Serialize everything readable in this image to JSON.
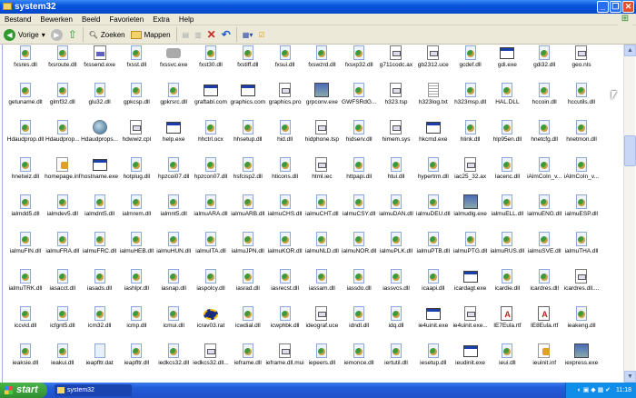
{
  "window": {
    "title": "system32"
  },
  "menu": [
    "Bestand",
    "Bewerken",
    "Beeld",
    "Favorieten",
    "Extra",
    "Help"
  ],
  "toolbar": {
    "back": "Vorige",
    "search": "Zoeken",
    "folders": "Mappen"
  },
  "rows": [
    [
      [
        "fxsres.dll",
        "d"
      ],
      [
        "fxsroute.dll",
        "d"
      ],
      [
        "fxssend.exe",
        "doc"
      ],
      [
        "fxsst.dll",
        "d"
      ],
      [
        "fxssvc.exe",
        "fax"
      ],
      [
        "fxst30.dll",
        "d"
      ],
      [
        "fxstiff.dll",
        "d"
      ],
      [
        "fxsui.dll",
        "d"
      ],
      [
        "fxswzrd.dll",
        "d"
      ],
      [
        "fxsxp32.dll",
        "d"
      ],
      [
        "g711codc.ax",
        "t"
      ],
      [
        "gb2312.uce",
        "t"
      ],
      [
        "gcdef.dll",
        "d"
      ],
      [
        "gdi.exe",
        "w"
      ],
      [
        "gdi32.dll",
        "d"
      ],
      [
        "geo.nls",
        "t"
      ]
    ],
    [
      [
        "getuname.dll",
        "d"
      ],
      [
        "glmf32.dll",
        "d"
      ],
      [
        "glu32.dll",
        "d"
      ],
      [
        "gpkcsp.dll",
        "d"
      ],
      [
        "gpkrsrc.dll",
        "d"
      ],
      [
        "graftabl.com",
        "w"
      ],
      [
        "graphics.com",
        "w"
      ],
      [
        "graphics.pro",
        "t"
      ],
      [
        "grpconv.exe",
        "app"
      ],
      [
        "GWFSRdG...",
        "d"
      ],
      [
        "h323.tsp",
        "t"
      ],
      [
        "h323log.txt",
        "txt"
      ],
      [
        "h323msp.dll",
        "d"
      ],
      [
        "HAL.DLL",
        "d"
      ],
      [
        "hccoin.dll",
        "d"
      ],
      [
        "hccutils.dll",
        "d"
      ]
    ],
    [
      [
        "Hdaudprop.dll",
        "d"
      ],
      [
        "Hdaudprop...",
        "d"
      ],
      [
        "Hdaudprops...",
        "globe"
      ],
      [
        "hdwwiz.cpl",
        "t"
      ],
      [
        "help.exe",
        "w"
      ],
      [
        "hhctrl.ocx",
        "d"
      ],
      [
        "hhsetup.dll",
        "d"
      ],
      [
        "hid.dll",
        "d"
      ],
      [
        "hidphone.tsp",
        "t"
      ],
      [
        "hidserv.dll",
        "d"
      ],
      [
        "himem.sys",
        "t"
      ],
      [
        "hkcmd.exe",
        "w"
      ],
      [
        "hlink.dll",
        "d"
      ],
      [
        "hlp95en.dll",
        "d"
      ],
      [
        "hnetcfg.dll",
        "d"
      ],
      [
        "hnetmon.dll",
        "d"
      ]
    ],
    [
      [
        "hnetwiz.dll",
        "d"
      ],
      [
        "homepage.inf",
        "inf"
      ],
      [
        "hostname.exe",
        "w"
      ],
      [
        "hotplug.dll",
        "d"
      ],
      [
        "hpzcoi07.dll",
        "d"
      ],
      [
        "hpzcon07.dll",
        "d"
      ],
      [
        "hsfcisp2.dll",
        "d"
      ],
      [
        "hticons.dll",
        "d"
      ],
      [
        "html.iec",
        "t"
      ],
      [
        "httpapi.dll",
        "d"
      ],
      [
        "htui.dll",
        "d"
      ],
      [
        "hypertrm.dll",
        "d"
      ],
      [
        "iac25_32.ax",
        "t"
      ],
      [
        "Iacenc.dll",
        "d"
      ],
      [
        "iAlmCoIn_v...",
        "d"
      ],
      [
        "iAlmCoIn_v...",
        "d"
      ]
    ],
    [
      [
        "ialmdd5.dll",
        "d"
      ],
      [
        "ialmdev5.dll",
        "d"
      ],
      [
        "ialmdnt5.dll",
        "d"
      ],
      [
        "ialmrem.dll",
        "d"
      ],
      [
        "ialmnt5.dll",
        "d"
      ],
      [
        "ialmuARA.dll",
        "d"
      ],
      [
        "ialmuARB.dll",
        "d"
      ],
      [
        "ialmuCHS.dll",
        "d"
      ],
      [
        "ialmuCHT.dll",
        "d"
      ],
      [
        "ialmuCSY.dll",
        "d"
      ],
      [
        "ialmuDAN.dll",
        "d"
      ],
      [
        "ialmuDEU.dll",
        "d"
      ],
      [
        "ialmudlg.exe",
        "app"
      ],
      [
        "ialmuELL.dll",
        "d"
      ],
      [
        "ialmuENG.dll",
        "d"
      ],
      [
        "ialmuESP.dll",
        "d"
      ]
    ],
    [
      [
        "ialmuFIN.dll",
        "d"
      ],
      [
        "ialmuFRA.dll",
        "d"
      ],
      [
        "ialmuFRC.dll",
        "d"
      ],
      [
        "ialmuHEB.dll",
        "d"
      ],
      [
        "ialmuHUN.dll",
        "d"
      ],
      [
        "ialmuITA.dll",
        "d"
      ],
      [
        "ialmuJPN.dll",
        "d"
      ],
      [
        "ialmuKOR.dll",
        "d"
      ],
      [
        "ialmuNLD.dll",
        "d"
      ],
      [
        "ialmuNOR.dll",
        "d"
      ],
      [
        "ialmuPLK.dll",
        "d"
      ],
      [
        "ialmuPTB.dll",
        "d"
      ],
      [
        "ialmuPTG.dll",
        "d"
      ],
      [
        "ialmuRUS.dll",
        "d"
      ],
      [
        "ialmuSVE.dll",
        "d"
      ],
      [
        "ialmuTHA.dll",
        "d"
      ]
    ],
    [
      [
        "ialmuTRK.dll",
        "d"
      ],
      [
        "iasacct.dll",
        "d"
      ],
      [
        "iasads.dll",
        "d"
      ],
      [
        "iashlpr.dll",
        "d"
      ],
      [
        "iasnap.dll",
        "d"
      ],
      [
        "iaspolcy.dll",
        "d"
      ],
      [
        "iasrad.dll",
        "d"
      ],
      [
        "iasrecst.dll",
        "d"
      ],
      [
        "iassam.dll",
        "d"
      ],
      [
        "iassdo.dll",
        "d"
      ],
      [
        "iassvcs.dll",
        "d"
      ],
      [
        "icaapi.dll",
        "d"
      ],
      [
        "icardagt.exe",
        "w"
      ],
      [
        "icardie.dll",
        "d"
      ],
      [
        "icardres.dll",
        "d"
      ],
      [
        "icardres.dll....",
        "t"
      ]
    ],
    [
      [
        "iccvid.dll",
        "d"
      ],
      [
        "icfgnt5.dll",
        "d"
      ],
      [
        "icm32.dll",
        "d"
      ],
      [
        "icmp.dll",
        "d"
      ],
      [
        "icmui.dll",
        "d"
      ],
      [
        "icrav03.rat",
        "rat"
      ],
      [
        "icwdial.dll",
        "d"
      ],
      [
        "icwphbk.dll",
        "d"
      ],
      [
        "ideograf.uce",
        "t"
      ],
      [
        "idndl.dll",
        "d"
      ],
      [
        "idq.dll",
        "d"
      ],
      [
        "ie4uinit.exe",
        "w"
      ],
      [
        "ie4uinit.exe...",
        "t"
      ],
      [
        "IE7Eula.rtf",
        "rtf"
      ],
      [
        "IE8Eula.rtf",
        "rtf"
      ],
      [
        "ieakeng.dll",
        "d"
      ]
    ],
    [
      [
        "ieaksie.dll",
        "d"
      ],
      [
        "ieakui.dll",
        "d"
      ],
      [
        "ieapfltr.dat",
        "dat"
      ],
      [
        "ieapfltr.dll",
        "d"
      ],
      [
        "iedkcs32.dll",
        "d"
      ],
      [
        "iedkcs32.dll...",
        "t"
      ],
      [
        "ieframe.dll",
        "d"
      ],
      [
        "ieframe.dll.mui",
        "t"
      ],
      [
        "iepeers.dll",
        "d"
      ],
      [
        "iemonce.dll",
        "d"
      ],
      [
        "iertutil.dll",
        "d"
      ],
      [
        "iesetup.dll",
        "d"
      ],
      [
        "ieudinit.exe",
        "w"
      ],
      [
        "ieui.dll",
        "d"
      ],
      [
        "ieuinit.inf",
        "inf"
      ],
      [
        "iexpress.exe",
        "app"
      ]
    ]
  ],
  "taskbar": {
    "start": "start",
    "task": "system32",
    "clock": "11:18"
  }
}
